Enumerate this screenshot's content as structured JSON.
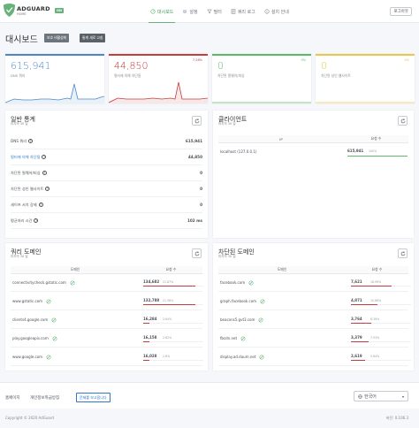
{
  "header": {
    "brand": "ADGUARD",
    "brand_sub": "HOME",
    "status_badge": "ON",
    "nav": [
      {
        "label": "대시보드",
        "icon": "dashboard-icon",
        "active": true
      },
      {
        "label": "설정",
        "icon": "gear-icon",
        "active": false
      },
      {
        "label": "필터",
        "icon": "filter-icon",
        "active": false
      },
      {
        "label": "쿼리 로그",
        "icon": "log-icon",
        "active": false
      },
      {
        "label": "설치 안내",
        "icon": "info-icon",
        "active": false
      }
    ],
    "logout": "로그아웃"
  },
  "page": {
    "title": "대시보드",
    "btn_protect": "보호 비활성화",
    "btn_refresh": "통계 새로 고침"
  },
  "stats": [
    {
      "value": "615,941",
      "label": "DNS 쿼리",
      "pct": "",
      "color": "#4c88c8"
    },
    {
      "value": "44,850",
      "label": "필터에 의해 차단됨",
      "pct": "7.28%",
      "color": "#c83c3c"
    },
    {
      "value": "0",
      "label": "차단된 멀웨어/피싱",
      "pct": "0%",
      "color": "#5dba6b"
    },
    {
      "value": "0",
      "label": "차단된 성인 웹사이트",
      "pct": "0%",
      "color": "#e9c748"
    }
  ],
  "general": {
    "title": "일반 통계",
    "sub": "마지막 30 일",
    "rows": [
      {
        "label": "DNS 쿼리",
        "value": "615,941",
        "link": false
      },
      {
        "label": "필터에 의해 차단됨",
        "value": "44,850",
        "link": true
      },
      {
        "label": "차단된 멀웨어/피싱",
        "value": "0",
        "link": false
      },
      {
        "label": "차단된 성인 웹사이트",
        "value": "0",
        "link": false
      },
      {
        "label": "세이프 서치 강제",
        "value": "0",
        "link": false
      },
      {
        "label": "평균처리 시간",
        "value": "102 ms",
        "link": false
      }
    ]
  },
  "clients": {
    "title": "클라이언트",
    "sub": "마지막 30 일",
    "col_ip": "IP",
    "col_req": "요청 수",
    "rows": [
      {
        "name": "localhost (127.0.0.1)",
        "count": "615,941",
        "pct": "100%",
        "fraction": 1.0
      }
    ]
  },
  "top_queried": {
    "title": "쿼리 도메인",
    "sub": "마지막 30 일",
    "col_domain": "도메인",
    "col_req": "요청 수",
    "bar_color": "#c83c3c",
    "rows": [
      {
        "domain": "connectivitycheck.gstatic.com",
        "count": "134,682",
        "pct": "21.87%",
        "fraction": 0.2187
      },
      {
        "domain": "www.gstatic.com",
        "count": "132,788",
        "pct": "21.56%",
        "fraction": 0.2156
      },
      {
        "domain": "clients4.google.com",
        "count": "16,284",
        "pct": "2.64%",
        "fraction": 0.0264
      },
      {
        "domain": "play.googleapis.com",
        "count": "16,158",
        "pct": "2.62%",
        "fraction": 0.0262
      },
      {
        "domain": "www.google.com",
        "count": "16,028",
        "pct": "2.6%",
        "fraction": 0.026
      }
    ]
  },
  "top_blocked": {
    "title": "차단된 도메인",
    "sub": "마지막 30 일",
    "col_domain": "도메인",
    "col_req": "요청 수",
    "bar_color": "#c83c3c",
    "rows": [
      {
        "domain": "facebook.com",
        "count": "7,621",
        "pct": "16.99%",
        "fraction": 0.1699
      },
      {
        "domain": "graph.facebook.com",
        "count": "4,871",
        "pct": "10.86%",
        "fraction": 0.1086
      },
      {
        "domain": "beacons5.gvt3.com",
        "count": "3,764",
        "pct": "8.39%",
        "fraction": 0.0839
      },
      {
        "domain": "fbcdn.net",
        "count": "3,379",
        "pct": "7.53%",
        "fraction": 0.0753
      },
      {
        "domain": "display.ad.daum.net",
        "count": "2,619",
        "pct": "5.84%",
        "fraction": 0.0584
      }
    ]
  },
  "footer": {
    "homepage": "홈페이지",
    "privacy": "개인정보취급방침",
    "report": "문제를 보고합니다",
    "language": "한국어",
    "copyright": "Copyright © 2020 AdGuard",
    "version": "버전: 0.106.3"
  }
}
